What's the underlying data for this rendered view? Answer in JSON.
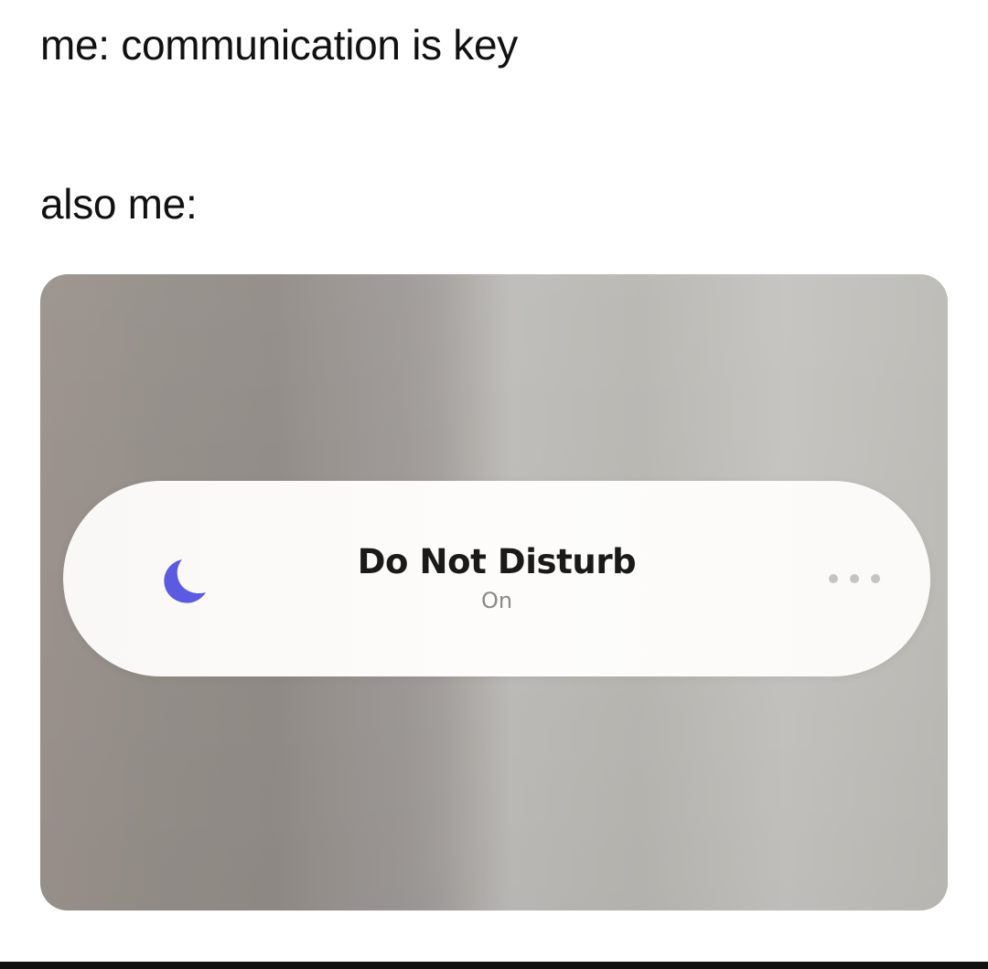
{
  "captions": {
    "line1": "me: communication is key",
    "line2": "also me:"
  },
  "dnd_banner": {
    "icon": "moon-icon",
    "icon_color": "#5a5be0",
    "title": "Do Not Disturb",
    "status": "On",
    "more_icon": "ellipsis-icon"
  },
  "colors": {
    "background": "#ffffff",
    "caption_text": "#111111",
    "status_text": "#8a8a8a"
  }
}
